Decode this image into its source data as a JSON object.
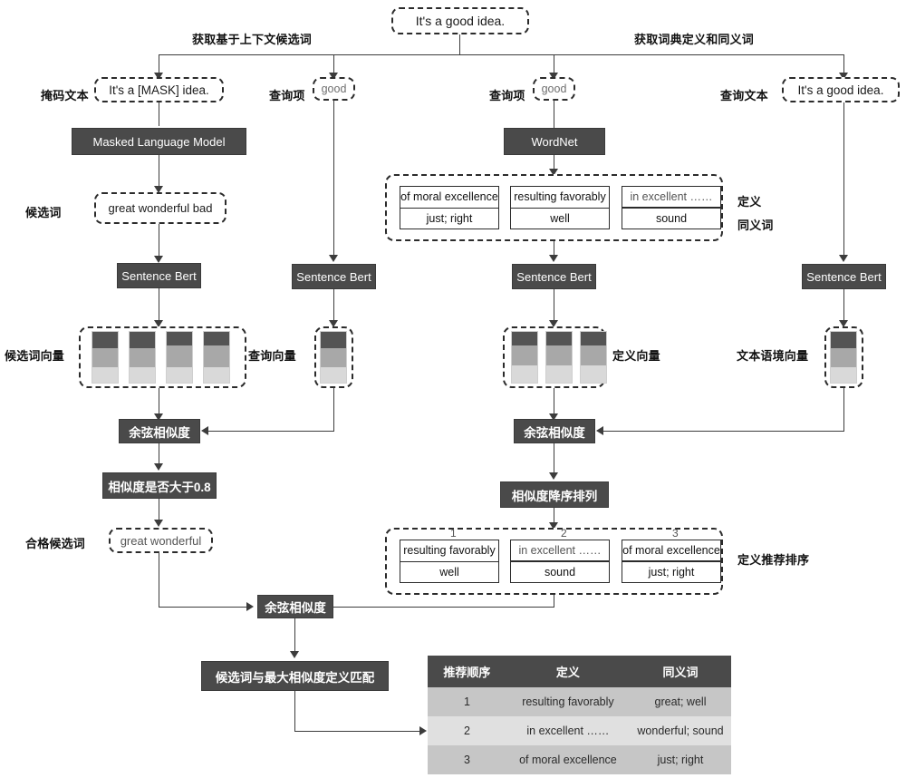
{
  "title": "Word sense recommendation pipeline diagram",
  "nodes": {
    "input_sentence": "It's a good idea.",
    "edge_left_label": "获取基于上下文候选词",
    "edge_right_label": "获取词典定义和同义词",
    "masked_text_label": "掩码文本",
    "masked_text": "It's a [MASK] idea.",
    "query_term_label_1": "查询项",
    "query_term_1": "good",
    "query_term_label_2": "查询项",
    "query_term_2": "good",
    "query_text_label": "查询文本",
    "query_text": "It's a good idea.",
    "mlm": "Masked Language Model",
    "wordnet": "WordNet",
    "candidates_label": "候选词",
    "candidates": "great  wonderful bad",
    "sentence_bert": "Sentence Bert",
    "def_label": "定义",
    "syn_label": "同义词",
    "candidate_vec_label": "候选词向量",
    "query_vec_label": "查询向量",
    "def_vec_label": "定义向量",
    "context_vec_label": "文本语境向量",
    "cosine_similarity": "余弦相似度",
    "threshold": "相似度是否大于0.8",
    "sort_desc": "相似度降序排列",
    "qualified_label": "合格候选词",
    "qualified": "great  wonderful",
    "def_rank_label": "定义推荐排序",
    "match_box": "候选词与最大相似度定义匹配"
  },
  "wordnet_definitions": [
    {
      "definition": "of moral excellence",
      "synonym": "just; right"
    },
    {
      "definition": "resulting favorably",
      "synonym": "well"
    },
    {
      "definition": "in excellent ……",
      "synonym": "sound"
    }
  ],
  "ranked_definitions": [
    {
      "rank": "1",
      "definition": "resulting favorably",
      "synonym": "well"
    },
    {
      "rank": "2",
      "definition": "in excellent ……",
      "synonym": "sound"
    },
    {
      "rank": "3",
      "definition": "of moral excellence",
      "synonym": "just; right"
    }
  ],
  "results_table": {
    "headers": [
      "推荐顺序",
      "定义",
      "同义词"
    ],
    "rows": [
      {
        "order": "1",
        "definition": "resulting favorably",
        "synonyms": "great;  well"
      },
      {
        "order": "2",
        "definition": "in excellent ……",
        "synonyms": "wonderful; sound"
      },
      {
        "order": "3",
        "definition": "of moral excellence",
        "synonyms": "just; right"
      }
    ]
  },
  "colors": {
    "dark_box": "#4a4a4a",
    "line": "#3c3c3c",
    "vector_top": "#545454",
    "vector_mid": "#a8a8a8",
    "vector_bottom": "#d9d9d9",
    "table_header": "#4a4a4a",
    "table_row_odd": "#c6c6c6",
    "table_row_even": "#e0e0e0"
  }
}
